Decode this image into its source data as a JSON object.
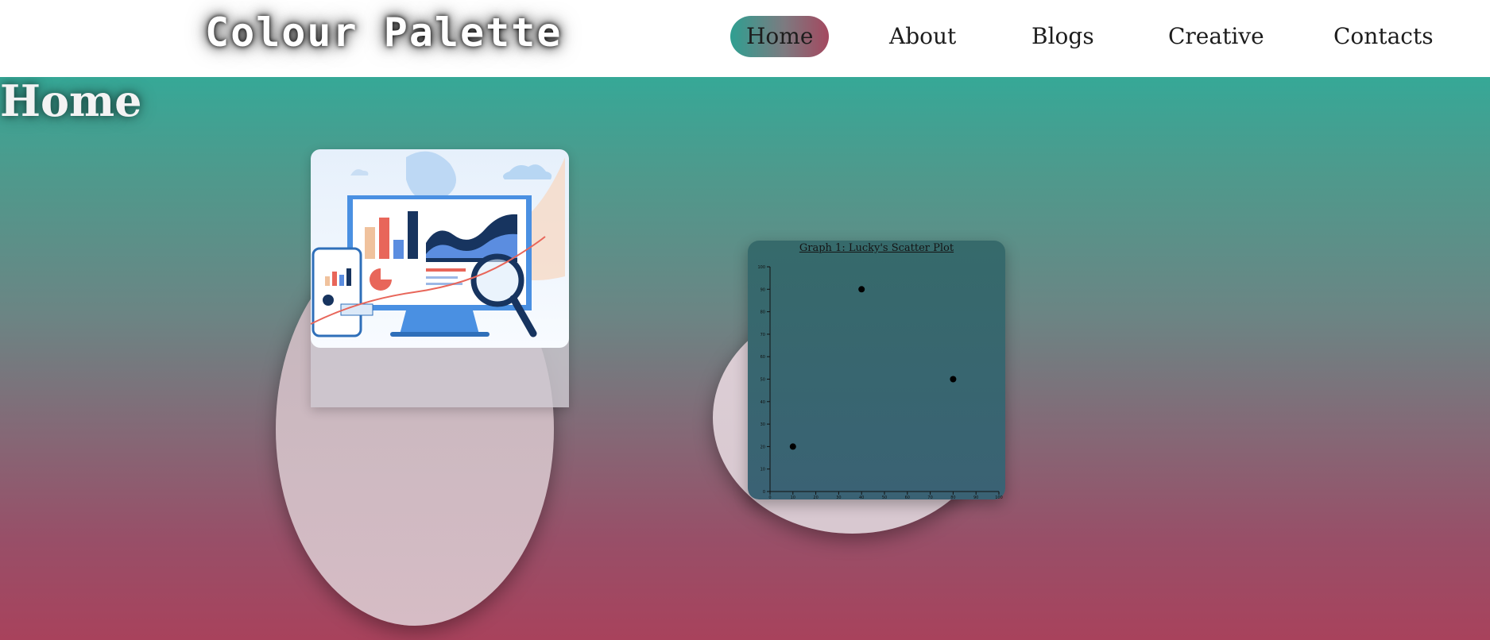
{
  "header": {
    "brand": "Colour Palette",
    "nav": [
      "Home",
      "About",
      "Blogs",
      "Creative",
      "Contacts"
    ],
    "active_index": 0
  },
  "main": {
    "page_title": "Home",
    "illustration_icon": "analytics-dashboard-illustration"
  },
  "colors": {
    "teal": "#36a897",
    "rose": "#a8425c",
    "white": "#ffffff"
  },
  "chart_data": {
    "type": "scatter",
    "title": "Graph 1: Lucky's Scatter Plot",
    "xlabel": "",
    "ylabel": "",
    "xlim": [
      0,
      100
    ],
    "ylim": [
      0,
      100
    ],
    "x_ticks": [
      0,
      10,
      20,
      30,
      40,
      50,
      60,
      70,
      80,
      90,
      100
    ],
    "y_ticks": [
      0,
      10,
      20,
      30,
      40,
      50,
      60,
      70,
      80,
      90,
      100
    ],
    "grid": false,
    "points": [
      {
        "x": 10,
        "y": 20
      },
      {
        "x": 40,
        "y": 90
      },
      {
        "x": 80,
        "y": 50
      }
    ]
  }
}
